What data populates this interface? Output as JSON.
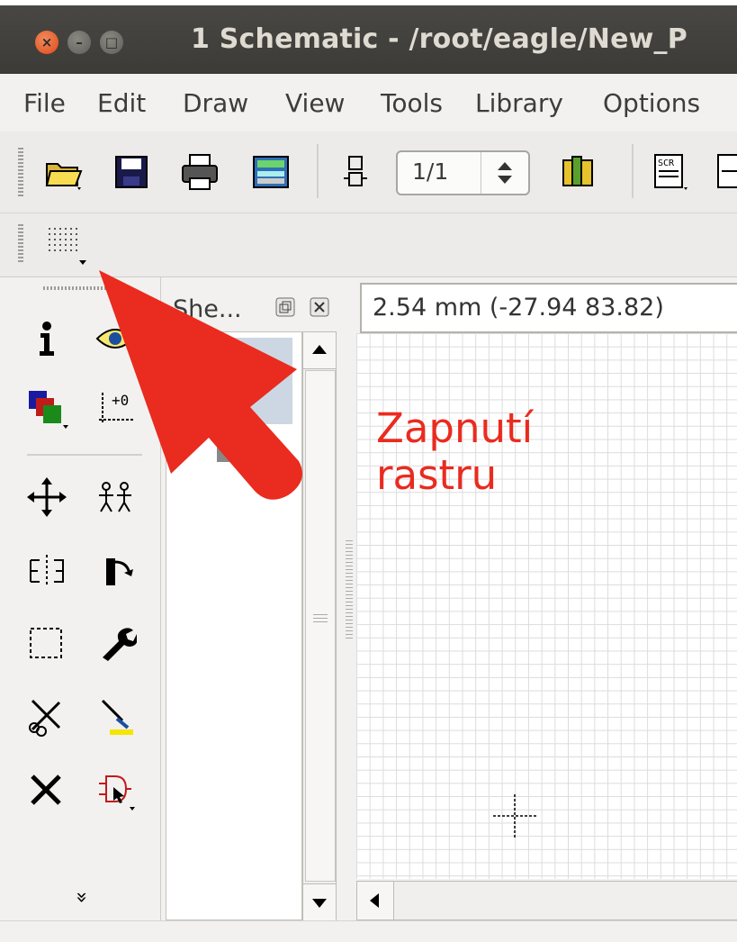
{
  "window": {
    "title": "1 Schematic - /root/eagle/New_P",
    "controls": [
      {
        "name": "close-icon",
        "glyph": "×"
      },
      {
        "name": "minimize-icon",
        "glyph": "–"
      },
      {
        "name": "maximize-icon",
        "glyph": "□"
      }
    ]
  },
  "menu": {
    "items": [
      "File",
      "Edit",
      "Draw",
      "View",
      "Tools",
      "Library",
      "Options"
    ]
  },
  "toolbar": {
    "icons": [
      "open-folder-icon",
      "save-icon",
      "print-icon",
      "export-icon",
      "sheet-icon",
      "book-icon",
      "script-icon"
    ],
    "page_value": "1/1",
    "spin_glyph": "⬍"
  },
  "grid_toolbar": {
    "icons": [
      "grid-icon"
    ]
  },
  "tools": {
    "icons": [
      "info-icon",
      "eye-icon",
      "layers-icon",
      "mark-icon",
      "move-icon",
      "copy-icon",
      "mirror-icon",
      "rotate-icon",
      "group-icon",
      "wrench-icon",
      "cut-icon",
      "paste-icon",
      "delete-icon",
      "add-part-icon"
    ],
    "expand_glyph": "»"
  },
  "sheets_panel": {
    "title": "She..."
  },
  "status": {
    "coordinates": "2.54 mm (-27.94 83.82)"
  },
  "annotation": {
    "text": "Zapnutí\nrastru",
    "color": "#ea2b1f"
  },
  "colors": {
    "titlebar": "#3c3b37",
    "close_button": "#df4a16",
    "window_bg": "#f2f1f0",
    "arrow": "#ea2b1f"
  }
}
